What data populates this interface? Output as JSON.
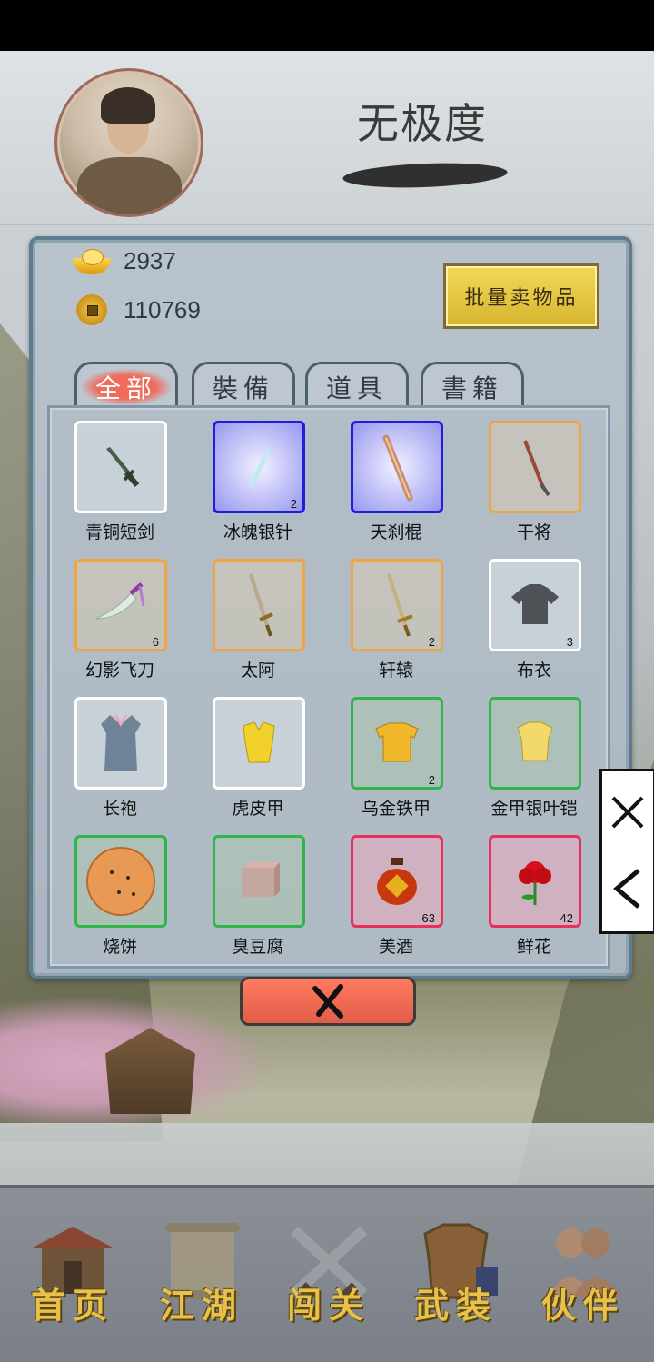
{
  "player": {
    "name": "无极度"
  },
  "currency": {
    "gold": "2937",
    "coins": "110769"
  },
  "actions": {
    "bulk_sell": "批量卖物品"
  },
  "tabs": [
    {
      "label": "全部",
      "active": true
    },
    {
      "label": "裝備",
      "active": false
    },
    {
      "label": "道具",
      "active": false
    },
    {
      "label": "書籍",
      "active": false
    }
  ],
  "items": [
    {
      "name": "青铜短剑",
      "rarity": "white",
      "qty": "",
      "icon": "bronze-sword-icon"
    },
    {
      "name": "冰魄银针",
      "rarity": "blue",
      "qty": "2",
      "icon": "silver-needle-icon"
    },
    {
      "name": "天刹棍",
      "rarity": "blue",
      "qty": "",
      "icon": "staff-icon"
    },
    {
      "name": "干将",
      "rarity": "orange",
      "qty": "",
      "icon": "sword-icon"
    },
    {
      "name": "幻影飞刀",
      "rarity": "orange",
      "qty": "6",
      "icon": "flying-knife-icon"
    },
    {
      "name": "太阿",
      "rarity": "orange",
      "qty": "",
      "icon": "sword-icon"
    },
    {
      "name": "轩辕",
      "rarity": "orange",
      "qty": "2",
      "icon": "sword-icon"
    },
    {
      "name": "布衣",
      "rarity": "white",
      "qty": "3",
      "icon": "cloth-shirt-icon"
    },
    {
      "name": "长袍",
      "rarity": "white",
      "qty": "",
      "icon": "robe-icon"
    },
    {
      "name": "虎皮甲",
      "rarity": "white",
      "qty": "",
      "icon": "tiger-armor-icon"
    },
    {
      "name": "乌金铁甲",
      "rarity": "green",
      "qty": "2",
      "icon": "iron-armor-icon"
    },
    {
      "name": "金甲银叶铠",
      "rarity": "green",
      "qty": "",
      "icon": "gold-armor-icon"
    },
    {
      "name": "烧饼",
      "rarity": "green",
      "qty": "",
      "icon": "sesame-cake-icon"
    },
    {
      "name": "臭豆腐",
      "rarity": "green",
      "qty": "",
      "icon": "tofu-icon"
    },
    {
      "name": "美酒",
      "rarity": "red",
      "qty": "63",
      "icon": "wine-jar-icon"
    },
    {
      "name": "鲜花",
      "rarity": "red",
      "qty": "42",
      "icon": "rose-icon"
    }
  ],
  "nav": [
    {
      "label": "首页",
      "icon": "pavilion-icon"
    },
    {
      "label": "江湖",
      "icon": "scroll-icon"
    },
    {
      "label": "闯关",
      "icon": "crossed-swords-icon"
    },
    {
      "label": "武装",
      "icon": "armor-icon"
    },
    {
      "label": "伙伴",
      "icon": "companions-icon"
    }
  ],
  "colors": {
    "white": "#ffffff",
    "blue": "#1e1ee0",
    "orange": "#f0a640",
    "green": "#2fb54a",
    "red": "#e8305a",
    "accent": "#e8c14a"
  }
}
